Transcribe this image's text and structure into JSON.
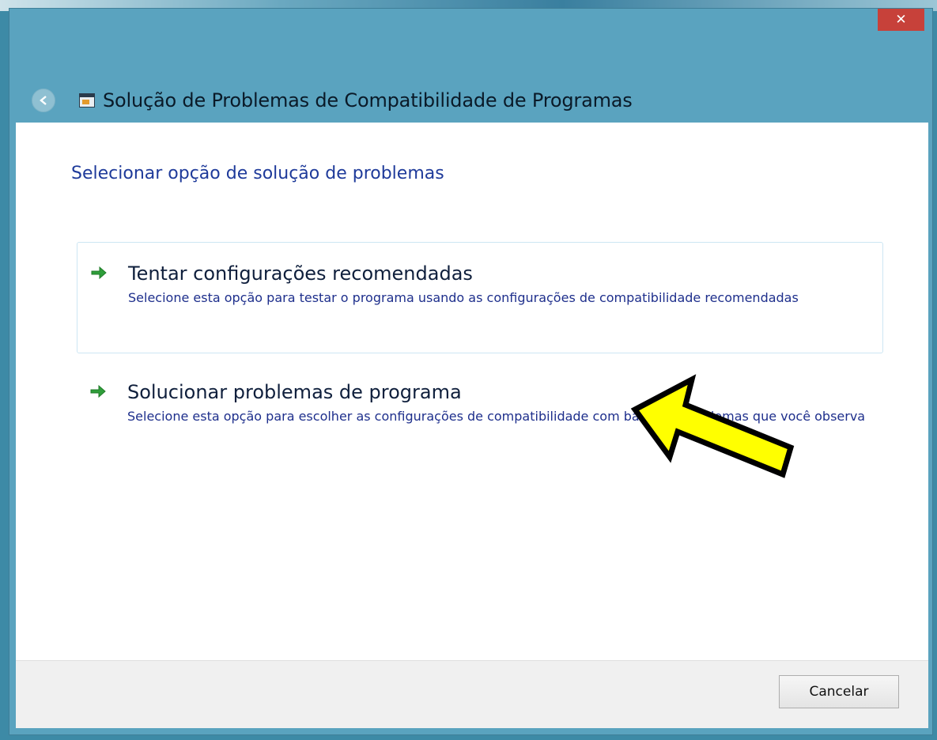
{
  "window": {
    "title": "Solução de Problemas de Compatibilidade de Programas",
    "close_label": "✕",
    "accent_color": "#5aa3bf"
  },
  "main": {
    "heading": "Selecionar opção de solução de problemas",
    "options": [
      {
        "title": "Tentar configurações recomendadas",
        "description": "Selecione esta opção para testar o programa usando as configurações de compatibilidade recomendadas",
        "icon": "green-arrow-icon"
      },
      {
        "title": "Solucionar problemas de programa",
        "description": "Selecione esta opção para escolher as configurações de compatibilidade com base em problemas que você observa",
        "icon": "green-arrow-icon"
      }
    ]
  },
  "footer": {
    "cancel_label": "Cancelar"
  },
  "annotation": {
    "icon": "yellow-pointer-arrow",
    "color": "#ffff00"
  }
}
